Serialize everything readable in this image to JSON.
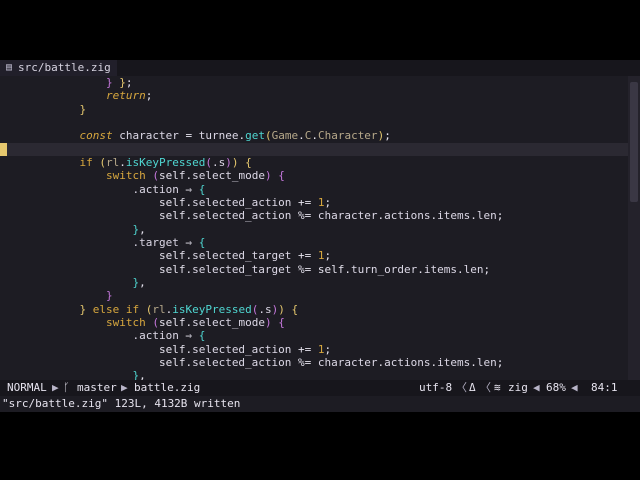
{
  "tab": {
    "icon": "file-icon",
    "filename": "src/battle.zig"
  },
  "code_lines": [
    {
      "segments": [
        {
          "t": "                ",
          "c": ""
        },
        {
          "t": "}",
          "c": "p2"
        },
        {
          "t": " ",
          "c": ""
        },
        {
          "t": "}",
          "c": "p1"
        },
        {
          "t": ";",
          "c": "op"
        }
      ]
    },
    {
      "segments": [
        {
          "t": "                ",
          "c": ""
        },
        {
          "t": "return",
          "c": "kw it"
        },
        {
          "t": ";",
          "c": "op"
        }
      ]
    },
    {
      "segments": [
        {
          "t": "            ",
          "c": ""
        },
        {
          "t": "}",
          "c": "p1"
        }
      ]
    },
    {
      "segments": []
    },
    {
      "segments": [
        {
          "t": "            ",
          "c": ""
        },
        {
          "t": "const",
          "c": "kw it"
        },
        {
          "t": " character ",
          "c": "fld"
        },
        {
          "t": "=",
          "c": "op"
        },
        {
          "t": " turnee",
          "c": "fld"
        },
        {
          "t": ".",
          "c": "op"
        },
        {
          "t": "get",
          "c": "fn"
        },
        {
          "t": "(",
          "c": "p1"
        },
        {
          "t": "Game",
          "c": "tp"
        },
        {
          "t": ".",
          "c": "op"
        },
        {
          "t": "C",
          "c": "tp"
        },
        {
          "t": ".",
          "c": "op"
        },
        {
          "t": "Character",
          "c": "tp"
        },
        {
          "t": ")",
          "c": "p1"
        },
        {
          "t": ";",
          "c": "op"
        }
      ]
    },
    {
      "segments": [],
      "current": true
    },
    {
      "segments": [
        {
          "t": "            ",
          "c": ""
        },
        {
          "t": "if",
          "c": "kw"
        },
        {
          "t": " ",
          "c": ""
        },
        {
          "t": "(",
          "c": "p1"
        },
        {
          "t": "rl",
          "c": "tp"
        },
        {
          "t": ".",
          "c": "op"
        },
        {
          "t": "isKeyPressed",
          "c": "fn"
        },
        {
          "t": "(",
          "c": "p2"
        },
        {
          "t": ".s",
          "c": "fld"
        },
        {
          "t": ")",
          "c": "p2"
        },
        {
          "t": ")",
          "c": "p1"
        },
        {
          "t": " ",
          "c": ""
        },
        {
          "t": "{",
          "c": "p1"
        }
      ]
    },
    {
      "segments": [
        {
          "t": "                ",
          "c": ""
        },
        {
          "t": "switch",
          "c": "kw"
        },
        {
          "t": " ",
          "c": ""
        },
        {
          "t": "(",
          "c": "p2"
        },
        {
          "t": "self",
          "c": "self"
        },
        {
          "t": ".",
          "c": "op"
        },
        {
          "t": "select_mode",
          "c": "fld"
        },
        {
          "t": ")",
          "c": "p2"
        },
        {
          "t": " ",
          "c": ""
        },
        {
          "t": "{",
          "c": "p2"
        }
      ]
    },
    {
      "segments": [
        {
          "t": "                    ",
          "c": ""
        },
        {
          "t": ".action",
          "c": "fld"
        },
        {
          "t": " ⇒ ",
          "c": "op"
        },
        {
          "t": "{",
          "c": "p3"
        }
      ]
    },
    {
      "segments": [
        {
          "t": "                        ",
          "c": ""
        },
        {
          "t": "self",
          "c": "self"
        },
        {
          "t": ".",
          "c": "op"
        },
        {
          "t": "selected_action",
          "c": "fld"
        },
        {
          "t": " += ",
          "c": "op"
        },
        {
          "t": "1",
          "c": "num"
        },
        {
          "t": ";",
          "c": "op"
        }
      ]
    },
    {
      "segments": [
        {
          "t": "                        ",
          "c": ""
        },
        {
          "t": "self",
          "c": "self"
        },
        {
          "t": ".",
          "c": "op"
        },
        {
          "t": "selected_action",
          "c": "fld"
        },
        {
          "t": " %= ",
          "c": "op"
        },
        {
          "t": "character",
          "c": "fld"
        },
        {
          "t": ".",
          "c": "op"
        },
        {
          "t": "actions",
          "c": "fld"
        },
        {
          "t": ".",
          "c": "op"
        },
        {
          "t": "items",
          "c": "fld"
        },
        {
          "t": ".",
          "c": "op"
        },
        {
          "t": "len",
          "c": "fld"
        },
        {
          "t": ";",
          "c": "op"
        }
      ]
    },
    {
      "segments": [
        {
          "t": "                    ",
          "c": ""
        },
        {
          "t": "}",
          "c": "p3"
        },
        {
          "t": ",",
          "c": "op"
        }
      ]
    },
    {
      "segments": [
        {
          "t": "                    ",
          "c": ""
        },
        {
          "t": ".target",
          "c": "fld"
        },
        {
          "t": " ⇒ ",
          "c": "op"
        },
        {
          "t": "{",
          "c": "p3"
        }
      ]
    },
    {
      "segments": [
        {
          "t": "                        ",
          "c": ""
        },
        {
          "t": "self",
          "c": "self"
        },
        {
          "t": ".",
          "c": "op"
        },
        {
          "t": "selected_target",
          "c": "fld"
        },
        {
          "t": " += ",
          "c": "op"
        },
        {
          "t": "1",
          "c": "num"
        },
        {
          "t": ";",
          "c": "op"
        }
      ]
    },
    {
      "segments": [
        {
          "t": "                        ",
          "c": ""
        },
        {
          "t": "self",
          "c": "self"
        },
        {
          "t": ".",
          "c": "op"
        },
        {
          "t": "selected_target",
          "c": "fld"
        },
        {
          "t": " %= ",
          "c": "op"
        },
        {
          "t": "self",
          "c": "self"
        },
        {
          "t": ".",
          "c": "op"
        },
        {
          "t": "turn_order",
          "c": "fld"
        },
        {
          "t": ".",
          "c": "op"
        },
        {
          "t": "items",
          "c": "fld"
        },
        {
          "t": ".",
          "c": "op"
        },
        {
          "t": "len",
          "c": "fld"
        },
        {
          "t": ";",
          "c": "op"
        }
      ]
    },
    {
      "segments": [
        {
          "t": "                    ",
          "c": ""
        },
        {
          "t": "}",
          "c": "p3"
        },
        {
          "t": ",",
          "c": "op"
        }
      ]
    },
    {
      "segments": [
        {
          "t": "                ",
          "c": ""
        },
        {
          "t": "}",
          "c": "p2"
        }
      ]
    },
    {
      "segments": [
        {
          "t": "            ",
          "c": ""
        },
        {
          "t": "}",
          "c": "p1"
        },
        {
          "t": " ",
          "c": ""
        },
        {
          "t": "else",
          "c": "kw"
        },
        {
          "t": " ",
          "c": ""
        },
        {
          "t": "if",
          "c": "kw"
        },
        {
          "t": " ",
          "c": ""
        },
        {
          "t": "(",
          "c": "p1"
        },
        {
          "t": "rl",
          "c": "tp"
        },
        {
          "t": ".",
          "c": "op"
        },
        {
          "t": "isKeyPressed",
          "c": "fn"
        },
        {
          "t": "(",
          "c": "p2"
        },
        {
          "t": ".s",
          "c": "fld"
        },
        {
          "t": ")",
          "c": "p2"
        },
        {
          "t": ")",
          "c": "p1"
        },
        {
          "t": " ",
          "c": ""
        },
        {
          "t": "{",
          "c": "p1"
        }
      ]
    },
    {
      "segments": [
        {
          "t": "                ",
          "c": ""
        },
        {
          "t": "switch",
          "c": "kw"
        },
        {
          "t": " ",
          "c": ""
        },
        {
          "t": "(",
          "c": "p2"
        },
        {
          "t": "self",
          "c": "self"
        },
        {
          "t": ".",
          "c": "op"
        },
        {
          "t": "select_mode",
          "c": "fld"
        },
        {
          "t": ")",
          "c": "p2"
        },
        {
          "t": " ",
          "c": ""
        },
        {
          "t": "{",
          "c": "p2"
        }
      ]
    },
    {
      "segments": [
        {
          "t": "                    ",
          "c": ""
        },
        {
          "t": ".action",
          "c": "fld"
        },
        {
          "t": " ⇒ ",
          "c": "op"
        },
        {
          "t": "{",
          "c": "p3"
        }
      ]
    },
    {
      "segments": [
        {
          "t": "                        ",
          "c": ""
        },
        {
          "t": "self",
          "c": "self"
        },
        {
          "t": ".",
          "c": "op"
        },
        {
          "t": "selected_action",
          "c": "fld"
        },
        {
          "t": " += ",
          "c": "op"
        },
        {
          "t": "1",
          "c": "num"
        },
        {
          "t": ";",
          "c": "op"
        }
      ]
    },
    {
      "segments": [
        {
          "t": "                        ",
          "c": ""
        },
        {
          "t": "self",
          "c": "self"
        },
        {
          "t": ".",
          "c": "op"
        },
        {
          "t": "selected_action",
          "c": "fld"
        },
        {
          "t": " %= ",
          "c": "op"
        },
        {
          "t": "character",
          "c": "fld"
        },
        {
          "t": ".",
          "c": "op"
        },
        {
          "t": "actions",
          "c": "fld"
        },
        {
          "t": ".",
          "c": "op"
        },
        {
          "t": "items",
          "c": "fld"
        },
        {
          "t": ".",
          "c": "op"
        },
        {
          "t": "len",
          "c": "fld"
        },
        {
          "t": ";",
          "c": "op"
        }
      ]
    },
    {
      "segments": [
        {
          "t": "                    ",
          "c": ""
        },
        {
          "t": "}",
          "c": "p3"
        },
        {
          "t": ",",
          "c": "op"
        }
      ]
    }
  ],
  "statusline": {
    "mode": "NORMAL",
    "branch_icon": "git-branch-icon",
    "branch": "master",
    "file": "battle.zig",
    "encoding": "utf-8",
    "fileformat_icon": "delta-icon",
    "filetype_icon": "zig-icon",
    "filetype": "zig",
    "percent": "68%",
    "position": "84:1"
  },
  "cmdline": {
    "message": "\"src/battle.zig\" 123L, 4132B written"
  }
}
